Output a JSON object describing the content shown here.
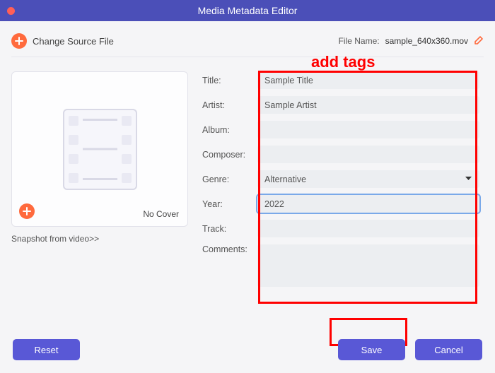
{
  "window": {
    "title": "Media Metadata Editor"
  },
  "topbar": {
    "change_source_label": "Change Source File",
    "filename_label": "File Name:",
    "filename_value": "sample_640x360.mov"
  },
  "annotation": {
    "add_tags": "add tags"
  },
  "cover": {
    "no_cover": "No Cover",
    "snapshot_link": "Snapshot from video>>"
  },
  "fields": {
    "title_label": "Title:",
    "title_value": "Sample Title",
    "artist_label": "Artist:",
    "artist_value": "Sample Artist",
    "album_label": "Album:",
    "album_value": "",
    "composer_label": "Composer:",
    "composer_value": "",
    "genre_label": "Genre:",
    "genre_value": "Alternative",
    "year_label": "Year:",
    "year_value": "2022",
    "track_label": "Track:",
    "track_value": "",
    "comments_label": "Comments:",
    "comments_value": ""
  },
  "footer": {
    "reset": "Reset",
    "save": "Save",
    "cancel": "Cancel"
  }
}
